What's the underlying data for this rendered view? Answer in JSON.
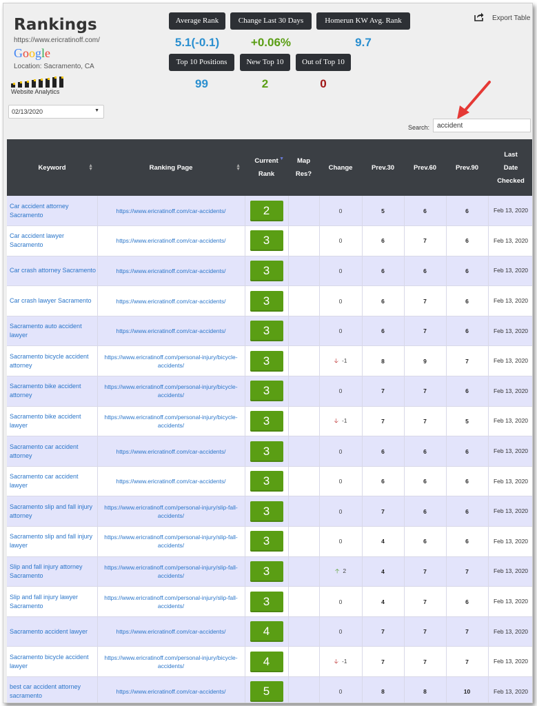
{
  "header": {
    "title": "Rankings",
    "url": "https://www.ericratinoff.com/",
    "search_engine": "Google",
    "location": "Location: Sacramento, CA",
    "analytics_label": "Website Analytics",
    "date_selected": "02/13/2020",
    "export_label": "Export Table",
    "search_label": "Search:",
    "search_value": "accident"
  },
  "stats": {
    "avg_rank_label": "Average Rank",
    "avg_rank_value": "5.1(-0.1)",
    "change_label": "Change Last 30 Days",
    "change_value": "+0.06%",
    "homerun_label": "Homerun KW Avg. Rank",
    "homerun_value": "9.7",
    "top10_label": "Top 10 Positions",
    "top10_value": "99",
    "new_top10_label": "New Top 10",
    "new_top10_value": "2",
    "out_top10_label": "Out of Top 10",
    "out_top10_value": "0"
  },
  "colors": {
    "blue_stat": "#2a8fd0",
    "green_stat": "#5a9e14",
    "red_stat": "#a01515",
    "rank_green": "#5a9e14"
  },
  "table": {
    "columns": {
      "keyword": "Keyword",
      "page": "Ranking Page",
      "current_rank_1": "Current",
      "current_rank_2": "Rank",
      "map_1": "Map",
      "map_2": "Res?",
      "change": "Change",
      "prev30": "Prev.30",
      "prev60": "Prev.60",
      "prev90": "Prev.90",
      "last_1": "Last",
      "last_2": "Date",
      "last_3": "Checked"
    },
    "rows": [
      {
        "kw": "Car accident attorney Sacramento",
        "page": "https://www.ericratinoff.com/car-accidents/",
        "rank": "2",
        "dir": "",
        "change": "0",
        "p30": "5",
        "p60": "6",
        "p90": "6",
        "date": "Feb 13, 2020"
      },
      {
        "kw": "Car accident lawyer Sacramento",
        "page": "https://www.ericratinoff.com/car-accidents/",
        "rank": "3",
        "dir": "",
        "change": "0",
        "p30": "6",
        "p60": "7",
        "p90": "6",
        "date": "Feb 13, 2020"
      },
      {
        "kw": "Car crash attorney Sacramento",
        "page": "https://www.ericratinoff.com/car-accidents/",
        "rank": "3",
        "dir": "",
        "change": "0",
        "p30": "6",
        "p60": "6",
        "p90": "6",
        "date": "Feb 13, 2020"
      },
      {
        "kw": "Car crash lawyer Sacramento",
        "page": "https://www.ericratinoff.com/car-accidents/",
        "rank": "3",
        "dir": "",
        "change": "0",
        "p30": "6",
        "p60": "7",
        "p90": "6",
        "date": "Feb 13, 2020"
      },
      {
        "kw": "Sacramento auto accident lawyer",
        "page": "https://www.ericratinoff.com/car-accidents/",
        "rank": "3",
        "dir": "",
        "change": "0",
        "p30": "6",
        "p60": "7",
        "p90": "6",
        "date": "Feb 13, 2020"
      },
      {
        "kw": "Sacramento bicycle accident attorney",
        "page": "https://www.ericratinoff.com/personal-injury/bicycle-accidents/",
        "rank": "3",
        "dir": "down",
        "change": "-1",
        "p30": "8",
        "p60": "9",
        "p90": "7",
        "date": "Feb 13, 2020"
      },
      {
        "kw": "Sacramento bike accident attorney",
        "page": "https://www.ericratinoff.com/personal-injury/bicycle-accidents/",
        "rank": "3",
        "dir": "",
        "change": "0",
        "p30": "7",
        "p60": "7",
        "p90": "6",
        "date": "Feb 13, 2020"
      },
      {
        "kw": "Sacramento bike accident lawyer",
        "page": "https://www.ericratinoff.com/personal-injury/bicycle-accidents/",
        "rank": "3",
        "dir": "down",
        "change": "-1",
        "p30": "7",
        "p60": "7",
        "p90": "5",
        "date": "Feb 13, 2020"
      },
      {
        "kw": "Sacramento car accident attorney",
        "page": "https://www.ericratinoff.com/car-accidents/",
        "rank": "3",
        "dir": "",
        "change": "0",
        "p30": "6",
        "p60": "6",
        "p90": "6",
        "date": "Feb 13, 2020"
      },
      {
        "kw": "Sacramento car accident lawyer",
        "page": "https://www.ericratinoff.com/car-accidents/",
        "rank": "3",
        "dir": "",
        "change": "0",
        "p30": "6",
        "p60": "6",
        "p90": "6",
        "date": "Feb 13, 2020"
      },
      {
        "kw": "Sacramento slip and fall injury attorney",
        "page": "https://www.ericratinoff.com/personal-injury/slip-fall-accidents/",
        "rank": "3",
        "dir": "",
        "change": "0",
        "p30": "7",
        "p60": "6",
        "p90": "6",
        "date": "Feb 13, 2020"
      },
      {
        "kw": "Sacramento slip and fall injury lawyer",
        "page": "https://www.ericratinoff.com/personal-injury/slip-fall-accidents/",
        "rank": "3",
        "dir": "",
        "change": "0",
        "p30": "4",
        "p60": "6",
        "p90": "6",
        "date": "Feb 13, 2020"
      },
      {
        "kw": "Slip and fall injury attorney Sacramento",
        "page": "https://www.ericratinoff.com/personal-injury/slip-fall-accidents/",
        "rank": "3",
        "dir": "up",
        "change": "2",
        "p30": "4",
        "p60": "7",
        "p90": "7",
        "date": "Feb 13, 2020"
      },
      {
        "kw": "Slip and fall injury lawyer Sacramento",
        "page": "https://www.ericratinoff.com/personal-injury/slip-fall-accidents/",
        "rank": "3",
        "dir": "",
        "change": "0",
        "p30": "4",
        "p60": "7",
        "p90": "6",
        "date": "Feb 13, 2020"
      },
      {
        "kw": "Sacramento accident lawyer",
        "page": "https://www.ericratinoff.com/car-accidents/",
        "rank": "4",
        "dir": "",
        "change": "0",
        "p30": "7",
        "p60": "7",
        "p90": "7",
        "date": "Feb 13, 2020"
      },
      {
        "kw": "Sacramento bicycle accident lawyer",
        "page": "https://www.ericratinoff.com/personal-injury/bicycle-accidents/",
        "rank": "4",
        "dir": "down",
        "change": "-1",
        "p30": "7",
        "p60": "7",
        "p90": "7",
        "date": "Feb 13, 2020"
      },
      {
        "kw": "best car accident attorney sacramento",
        "page": "https://www.ericratinoff.com/car-accidents/",
        "rank": "5",
        "dir": "",
        "change": "0",
        "p30": "8",
        "p60": "8",
        "p90": "10",
        "date": "Feb 13, 2020"
      }
    ]
  }
}
